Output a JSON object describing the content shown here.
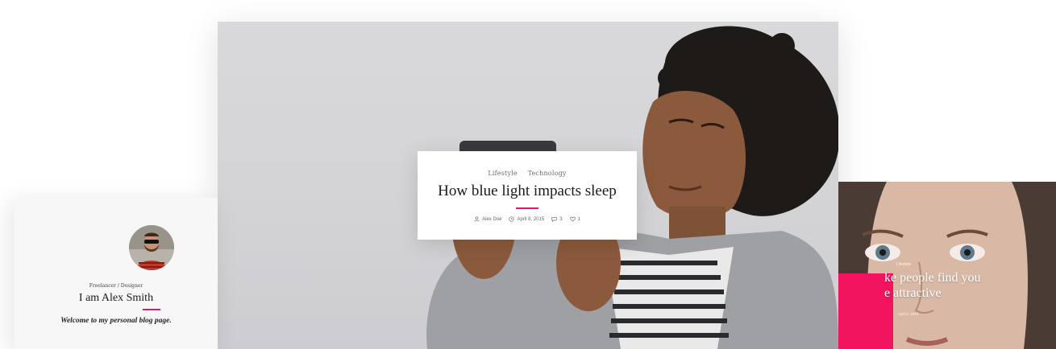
{
  "hero": {
    "categories": [
      "Lifestyle",
      "Technology"
    ],
    "title": "How blue light impacts sleep",
    "author": "Alex Doe",
    "date": "April 8, 2015",
    "comments": "3",
    "likes": "1"
  },
  "profile": {
    "role": "Freelancer / Designer",
    "name": "I am Alex Smith",
    "welcome": "Welcome to my personal blog page."
  },
  "right_card": {
    "category": "Lifestyle",
    "title_line1": "ke people find you",
    "title_line2": "e attractive",
    "meta": "April 8, 2015"
  },
  "colors": {
    "accent": "#e2166f",
    "pink_block": "#f2145e"
  },
  "icons": {
    "author": "user-icon",
    "date": "clock-icon",
    "comments": "comment-icon",
    "likes": "heart-icon"
  }
}
